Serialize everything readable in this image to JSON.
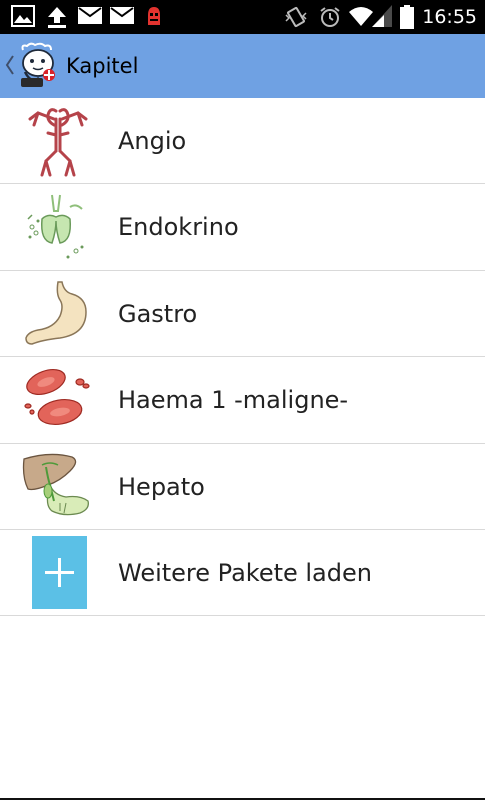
{
  "status_bar": {
    "time": "16:55",
    "icons": [
      "gallery-icon",
      "upload-icon",
      "gmail-icon",
      "gmail-icon",
      "robot-icon",
      "vibrate-icon",
      "alarm-icon",
      "wifi-icon",
      "signal-icon",
      "battery-icon"
    ]
  },
  "action_bar": {
    "title": "Kapitel",
    "up_icon": "chevron-left-icon",
    "logo_icon": "doctor-stethoscope-logo"
  },
  "chapters": [
    {
      "label": "Angio",
      "icon": "blood-vessels-icon"
    },
    {
      "label": "Endokrino",
      "icon": "thyroid-glands-icon"
    },
    {
      "label": "Gastro",
      "icon": "stomach-icon"
    },
    {
      "label": "Haema 1  -maligne-",
      "icon": "red-blood-cells-icon"
    },
    {
      "label": "Hepato",
      "icon": "liver-icon"
    }
  ],
  "more_packages": {
    "label": "Weitere Pakete laden",
    "icon": "plus-icon"
  },
  "colors": {
    "action_bar": "#6fa1e3",
    "plus_tile": "#5bc0e6",
    "divider": "#d9d9d9",
    "status_bar": "#000000"
  }
}
